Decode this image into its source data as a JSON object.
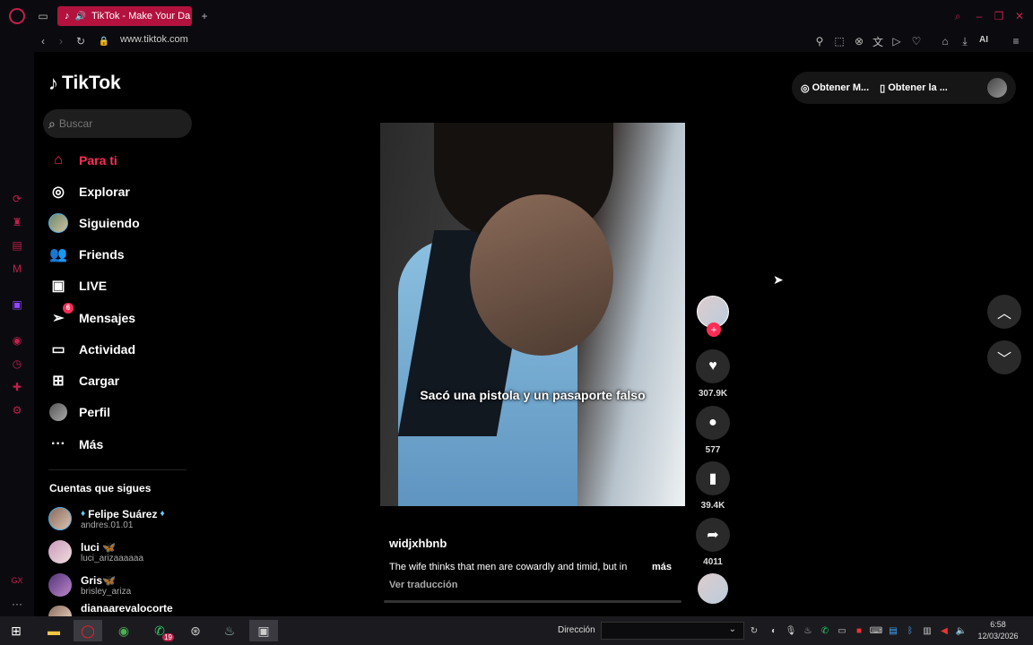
{
  "browser": {
    "tab_title": "TikTok - Make Your Da",
    "url": "www.tiktok.com",
    "ai_label": "AI",
    "accent": "#c0204a"
  },
  "tiktok": {
    "logo": "TikTok",
    "search_placeholder": "Buscar",
    "nav": [
      {
        "label": "Para ti",
        "icon": "home-icon"
      },
      {
        "label": "Explorar",
        "icon": "compass-icon"
      },
      {
        "label": "Siguiendo",
        "icon": "avatar-icon"
      },
      {
        "label": "Friends",
        "icon": "friends-icon"
      },
      {
        "label": "LIVE",
        "icon": "live-icon"
      },
      {
        "label": "Mensajes",
        "icon": "messages-icon",
        "badge": "6"
      },
      {
        "label": "Actividad",
        "icon": "activity-icon"
      },
      {
        "label": "Cargar",
        "icon": "upload-icon"
      },
      {
        "label": "Perfil",
        "icon": "profile-icon"
      },
      {
        "label": "Más",
        "icon": "more-icon"
      }
    ],
    "following_title": "Cuentas que sigues",
    "following": [
      {
        "name": "Felipe Suárez",
        "handle": "andres.01.01"
      },
      {
        "name": "luci 🦋",
        "handle": "luci_arizaaaaaa"
      },
      {
        "name": "Gris🦋",
        "handle": "brisley_ariza"
      },
      {
        "name": "dianaarevalocorte",
        "handle": ""
      }
    ],
    "top_buttons": [
      "Obtener M...",
      "Obtener la ..."
    ],
    "video": {
      "caption": "Sacó una pistola y un pasaporte falso",
      "author": "widjxhbnb",
      "description": "The wife thinks that men are cowardly and timid, but in",
      "more": "más",
      "translate": "Ver traducción"
    },
    "actions": {
      "likes": "307.9K",
      "comments": "577",
      "saves": "39.4K",
      "shares": "4011"
    }
  },
  "taskbar": {
    "address_label": "Dirección",
    "time": "6:58",
    "date": "12/03/2026",
    "whatsapp_badge": "19"
  }
}
